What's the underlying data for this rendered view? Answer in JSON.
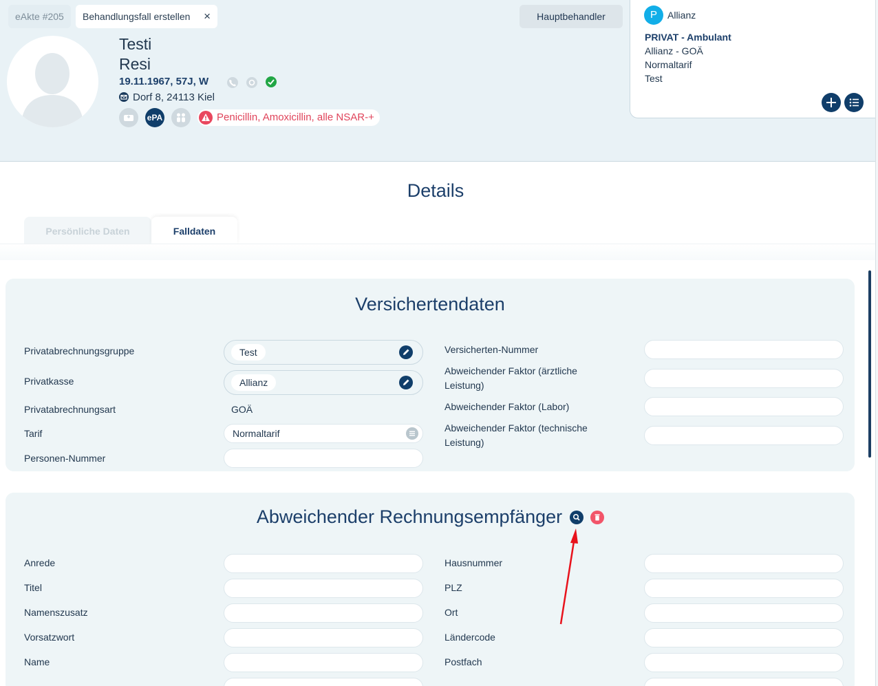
{
  "header": {
    "tabs": [
      {
        "label": "eAkte #205"
      },
      {
        "label": "Behandlungsfall erstellen",
        "close_icon": "×"
      }
    ],
    "main_practitioner_button": "Hauptbehandler",
    "patient": {
      "first_name": "Testi",
      "last_name": "Resi",
      "dob_info": "19.11.1967, 57J, W",
      "address": "Dorf 8, 24113 Kiel",
      "epa_label": "ePA",
      "allergy": "Penicillin, Amoxicillin, alle NSAR-+"
    },
    "insurance": {
      "badge": "P",
      "name": "Allianz",
      "type": "PRIVAT - Ambulant",
      "lines": [
        "Allianz - GOÄ",
        "Normaltarif",
        "Test"
      ]
    }
  },
  "details": {
    "title": "Details",
    "tabs": [
      "Persönliche Daten",
      "Falldaten"
    ],
    "active_tab": "Falldaten"
  },
  "versichertendaten": {
    "title": "Versichertendaten",
    "left": {
      "privatabrechnungsgruppe_label": "Privatabrechnungsgruppe",
      "privatabrechnungsgruppe_value": "Test",
      "privatkasse_label": "Privatkasse",
      "privatkasse_value": "Allianz",
      "privatabrechnungsart_label": "Privatabrechnungsart",
      "privatabrechnungsart_value": "GOÄ",
      "tarif_label": "Tarif",
      "tarif_value": "Normaltarif",
      "personen_nummer_label": "Personen-Nummer"
    },
    "right": {
      "versicherten_nummer_label": "Versicherten-Nummer",
      "faktor_aerztlich_label": "Abweichender Faktor (ärztliche Leistung)",
      "faktor_labor_label": "Abweichender Faktor (Labor)",
      "faktor_technisch_label": "Abweichender Faktor (technische Leistung)"
    }
  },
  "rechnungsempfaenger": {
    "title": "Abweichender Rechnungsempfänger",
    "left_labels": [
      "Anrede",
      "Titel",
      "Namenszusatz",
      "Vorsatzwort",
      "Name"
    ],
    "right_labels": [
      "Hausnummer",
      "PLZ",
      "Ort",
      "Ländercode",
      "Postfach"
    ]
  },
  "colors": {
    "primary": "#103e6a",
    "accent_blue": "#12aee8",
    "danger": "#f25469",
    "arrow": "#e8121c"
  }
}
